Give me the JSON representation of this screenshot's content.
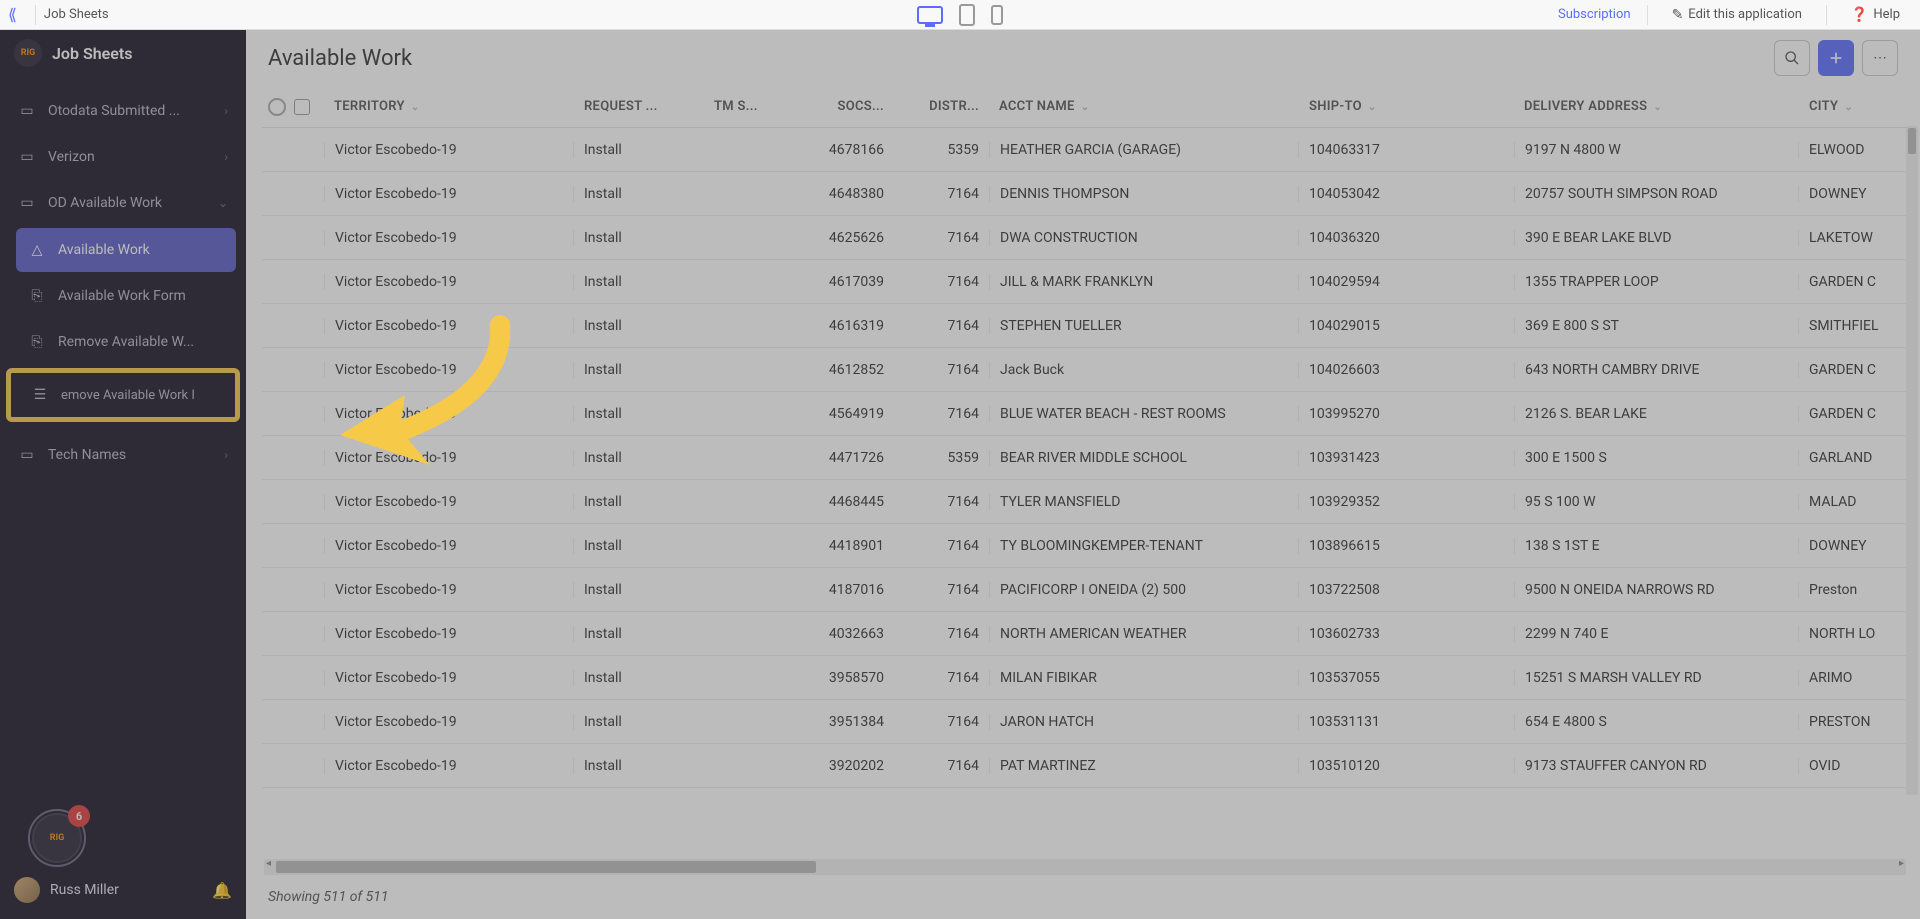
{
  "topbar": {
    "breadcrumb": "Job Sheets",
    "subscription": "Subscription",
    "edit_app": "Edit this application",
    "help": "Help"
  },
  "sidebar": {
    "app_title": "Job Sheets",
    "logo_text": "RIG",
    "nav": {
      "otodata": "Otodata Submitted ...",
      "verizon": "Verizon",
      "od_available": "OD Available Work",
      "available_work": "Available Work",
      "available_work_form": "Available Work Form",
      "remove_available_w": "Remove Available W...",
      "remove_available_work_highlight": "emove Available Work I",
      "tech_names": "Tech Names"
    },
    "badge_count": "6",
    "user_name": "Russ Miller",
    "avatar_text": "RIG"
  },
  "main": {
    "page_title": "Available Work",
    "columns": {
      "territory": "TERRITORY",
      "request": "REQUEST ...",
      "tms": "TM S...",
      "socs": "SOCS...",
      "distr": "DISTR...",
      "acct": "ACCT NAME",
      "shipto": "SHIP-TO",
      "delivery": "DELIVERY ADDRESS",
      "city": "CITY"
    },
    "rows": [
      {
        "territory": "Victor Escobedo-19",
        "request": "Install",
        "tms": "",
        "socs": "4678166",
        "distr": "5359",
        "acct": "HEATHER GARCIA (GARAGE)",
        "shipto": "104063317",
        "deliv": "9197 N 4800 W",
        "city": "ELWOOD"
      },
      {
        "territory": "Victor Escobedo-19",
        "request": "Install",
        "tms": "",
        "socs": "4648380",
        "distr": "7164",
        "acct": "DENNIS THOMPSON",
        "shipto": "104053042",
        "deliv": "20757 SOUTH SIMPSON ROAD",
        "city": "DOWNEY"
      },
      {
        "territory": "Victor Escobedo-19",
        "request": "Install",
        "tms": "",
        "socs": "4625626",
        "distr": "7164",
        "acct": "DWA CONSTRUCTION",
        "shipto": "104036320",
        "deliv": "390 E BEAR LAKE BLVD",
        "city": "LAKETOW"
      },
      {
        "territory": "Victor Escobedo-19",
        "request": "Install",
        "tms": "",
        "socs": "4617039",
        "distr": "7164",
        "acct": "JILL & MARK FRANKLYN",
        "shipto": "104029594",
        "deliv": "1355 TRAPPER LOOP",
        "city": "GARDEN C"
      },
      {
        "territory": "Victor Escobedo-19",
        "request": "Install",
        "tms": "",
        "socs": "4616319",
        "distr": "7164",
        "acct": "STEPHEN TUELLER",
        "shipto": "104029015",
        "deliv": "369 E 800 S ST",
        "city": "SMITHFIEL"
      },
      {
        "territory": "Victor Escobedo-19",
        "request": "Install",
        "tms": "",
        "socs": "4612852",
        "distr": "7164",
        "acct": "Jack Buck",
        "shipto": "104026603",
        "deliv": "643 NORTH CAMBRY DRIVE",
        "city": "GARDEN C"
      },
      {
        "territory": "Victor Escobedo-19",
        "request": "Install",
        "tms": "",
        "socs": "4564919",
        "distr": "7164",
        "acct": "BLUE WATER BEACH - REST ROOMS",
        "shipto": "103995270",
        "deliv": "2126 S. BEAR LAKE",
        "city": "GARDEN C"
      },
      {
        "territory": "Victor Escobedo-19",
        "request": "Install",
        "tms": "",
        "socs": "4471726",
        "distr": "5359",
        "acct": "BEAR RIVER MIDDLE SCHOOL",
        "shipto": "103931423",
        "deliv": "300 E 1500 S",
        "city": "GARLAND"
      },
      {
        "territory": "Victor Escobedo-19",
        "request": "Install",
        "tms": "",
        "socs": "4468445",
        "distr": "7164",
        "acct": "TYLER MANSFIELD",
        "shipto": "103929352",
        "deliv": "95 S 100 W",
        "city": "MALAD"
      },
      {
        "territory": "Victor Escobedo-19",
        "request": "Install",
        "tms": "",
        "socs": "4418901",
        "distr": "7164",
        "acct": "TY BLOOMINGKEMPER-TENANT",
        "shipto": "103896615",
        "deliv": "138 S 1ST E",
        "city": "DOWNEY"
      },
      {
        "territory": "Victor Escobedo-19",
        "request": "Install",
        "tms": "",
        "socs": "4187016",
        "distr": "7164",
        "acct": "PACIFICORP I ONEIDA (2) 500",
        "shipto": "103722508",
        "deliv": "9500 N ONEIDA NARROWS RD",
        "city": "Preston"
      },
      {
        "territory": "Victor Escobedo-19",
        "request": "Install",
        "tms": "",
        "socs": "4032663",
        "distr": "7164",
        "acct": "NORTH AMERICAN WEATHER",
        "shipto": "103602733",
        "deliv": "2299 N 740 E",
        "city": "NORTH LO"
      },
      {
        "territory": "Victor Escobedo-19",
        "request": "Install",
        "tms": "",
        "socs": "3958570",
        "distr": "7164",
        "acct": "MILAN FIBIKAR",
        "shipto": "103537055",
        "deliv": "15251 S MARSH VALLEY RD",
        "city": "ARIMO"
      },
      {
        "territory": "Victor Escobedo-19",
        "request": "Install",
        "tms": "",
        "socs": "3951384",
        "distr": "7164",
        "acct": "JARON HATCH",
        "shipto": "103531131",
        "deliv": "654 E 4800 S",
        "city": "PRESTON"
      },
      {
        "territory": "Victor Escobedo-19",
        "request": "Install",
        "tms": "",
        "socs": "3920202",
        "distr": "7164",
        "acct": "PAT MARTINEZ",
        "shipto": "103510120",
        "deliv": "9173 STAUFFER CANYON RD",
        "city": "OVID"
      }
    ],
    "status": "Showing 511 of 511"
  }
}
